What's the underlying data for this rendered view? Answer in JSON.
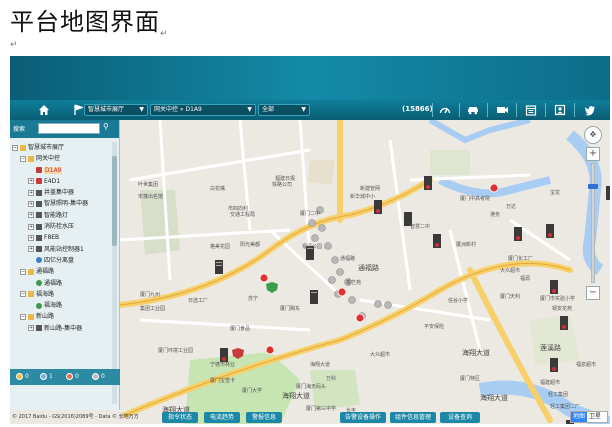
{
  "document": {
    "title": "平台地图界面",
    "para_mark": "↵"
  },
  "colors": {
    "topbar": "#0e7a96",
    "navbar": "#0a6079",
    "sidebar_header": "#1a7a95",
    "river": "#a9cdf2",
    "road_main": "#f7d06a",
    "road_secondary": "#ffffff",
    "park": "#c6e5b3",
    "block": "#eeeae3"
  },
  "navbar": {
    "home_icon": "home-icon",
    "flag_icon": "flag-icon",
    "dropdown_area": "智慧城市展厅",
    "dropdown_node": "网关中控 » D1A9",
    "dropdown_filter": "全部",
    "count": "(15866)",
    "icons": [
      "speedometer-icon",
      "car-icon",
      "camera-icon",
      "calendar-icon",
      "user-card-icon",
      "twitter-icon"
    ]
  },
  "sidebar": {
    "search_label": "搜索",
    "tree": [
      {
        "label": "智慧城市展厅",
        "depth": 0,
        "toggle": "⊟",
        "icon": "folder"
      },
      {
        "label": "网关中控",
        "depth": 1,
        "toggle": "⊟",
        "icon": "folder"
      },
      {
        "label": "D1A9",
        "depth": 2,
        "toggle": "",
        "icon": "dev",
        "highlight": true
      },
      {
        "label": "E4D1",
        "depth": 2,
        "toggle": "⊞",
        "icon": "dev"
      },
      {
        "label": "井盖集中器",
        "depth": 2,
        "toggle": "⊞",
        "icon": "srv"
      },
      {
        "label": "智慧照明-集中器",
        "depth": 2,
        "toggle": "⊞",
        "icon": "srv"
      },
      {
        "label": "智能路灯",
        "depth": 2,
        "toggle": "⊞",
        "icon": "srv"
      },
      {
        "label": "消防栓水压",
        "depth": 2,
        "toggle": "⊞",
        "icon": "srv"
      },
      {
        "label": "F8EB",
        "depth": 2,
        "toggle": "⊞",
        "icon": "srv"
      },
      {
        "label": "风能站控制器1",
        "depth": 2,
        "toggle": "⊞",
        "icon": "srv"
      },
      {
        "label": "四亿分离盘",
        "depth": 2,
        "toggle": "",
        "icon": "lnk"
      },
      {
        "label": "通福路",
        "depth": 1,
        "toggle": "⊟",
        "icon": "folder"
      },
      {
        "label": "通福路",
        "depth": 2,
        "toggle": "",
        "icon": "cam"
      },
      {
        "label": "福海路",
        "depth": 1,
        "toggle": "⊟",
        "icon": "folder"
      },
      {
        "label": "福海路",
        "depth": 2,
        "toggle": "",
        "icon": "cam"
      },
      {
        "label": "新山路",
        "depth": 1,
        "toggle": "⊟",
        "icon": "folder"
      },
      {
        "label": "新山路-集中器",
        "depth": 2,
        "toggle": "⊞",
        "icon": "srv"
      }
    ],
    "status": [
      {
        "value": "0",
        "color": "#f1c232"
      },
      {
        "value": "1",
        "color": "#6fb5e8"
      },
      {
        "value": "0",
        "color": "#e8704f"
      },
      {
        "value": "0",
        "color": "#bdbdbd"
      }
    ]
  },
  "map_labels": {
    "roads": [
      "通福路",
      "海翔大道",
      "海翔大道",
      "海翔大道",
      "莲溪路",
      "海翔大道"
    ],
    "pois": [
      "叶世集团",
      "宋藩出名馆",
      "白花嘴",
      "市四向利",
      "交通工程局",
      "厦门二中",
      "新华城中小",
      "厦门中高考院",
      "福建日报",
      "铁路公司",
      "新建管网",
      "福清公园",
      "阳光美都",
      "格美花园",
      "日选工厂",
      "厦门九州",
      "集团工业园",
      "厦门赐东",
      "通福路",
      "香艺苑",
      "苏宁",
      "智慧二中",
      "平安保险",
      "信谷小学",
      "厦门食品",
      "厦洲新村",
      "海翔大道",
      "厦门环境工业园",
      "宁德市林业",
      "厦门宝雪卡",
      "厦门大学",
      "厦门海天码头",
      "万科",
      "长丰",
      "厦门第三中学",
      "厦门特区",
      "宝龙",
      "万达",
      "港务",
      "大众超市",
      "福源",
      "厦门市实验小学",
      "铜安花苑",
      "福建超市",
      "轻工集团",
      "轻工集团二厂",
      "厦门化工厂",
      "大众超市",
      "厦门天利",
      "福泉超市"
    ]
  },
  "copyright": "© 2017 Baidu - GS(2016)2089号 - Data © 长地万方",
  "map_type": {
    "active": "地图",
    "inactive": "卫星"
  },
  "bottom_buttons": [
    "指令状态",
    "电流趋势",
    "警报信息",
    "告警设备操作",
    "组件信息管理",
    "设备查询"
  ]
}
